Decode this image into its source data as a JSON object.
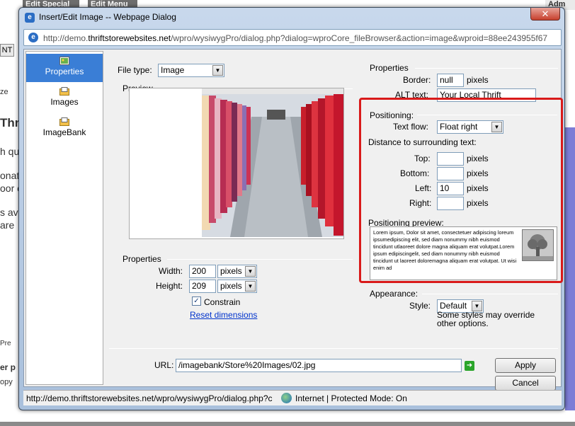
{
  "background_page": {
    "tab1": "Edit Special",
    "tab2": "Edit Menu",
    "tab3": "Adm",
    "button_nt": "NT",
    "frag_ze": "ze",
    "frag_thr": "Thr",
    "frag_h_qu": "h qu",
    "frag_onat": "onat",
    "frag_oor_c": "oor c",
    "frag_s_ava": "s ava",
    "frag_are": "are",
    "frag_pre": "Pre",
    "frag_er_p": "er p",
    "frag_opy": "opy"
  },
  "window": {
    "title": "Insert/Edit Image -- Webpage Dialog",
    "close_label": "✕",
    "url_prefix": "http://demo.",
    "url_domain": "thriftstorewebsites.net",
    "url_rest": "/wpro/wysiwygPro/dialog.php?dialog=wproCore_fileBrowser&action=image&wproid=88ee243955f67"
  },
  "nav": {
    "items": [
      {
        "label": "Properties",
        "active": true
      },
      {
        "label": "Images",
        "active": false
      },
      {
        "label": "ImageBank",
        "active": false
      }
    ]
  },
  "filetype": {
    "label": "File type:",
    "value": "Image"
  },
  "preview": {
    "label": "Preview"
  },
  "left_properties": {
    "label": "Properties",
    "width_label": "Width:",
    "width_value": "200",
    "width_unit": "pixels",
    "height_label": "Height:",
    "height_value": "209",
    "height_unit": "pixels",
    "constrain_label": "Constrain",
    "constrain_checked": true,
    "reset_label": "Reset dimensions"
  },
  "right_properties": {
    "label": "Properties",
    "border_label": "Border:",
    "border_value": "null",
    "border_unit": "pixels",
    "alt_label": "ALT text:",
    "alt_value": "Your Local Thrift"
  },
  "positioning": {
    "label": "Positioning:",
    "textflow_label": "Text flow:",
    "textflow_value": "Float right",
    "distance_label": "Distance to surrounding text:",
    "top_label": "Top:",
    "top_value": "",
    "bottom_label": "Bottom:",
    "bottom_value": "",
    "left_label": "Left:",
    "left_value": "10",
    "right_label": "Right:",
    "right_value": "",
    "unit": "pixels",
    "preview_label": "Positioning preview:",
    "preview_text": "Lorem ipsum, Dolor sit amet, consectetuer adipiscing loreum ipsumedipiscing elit, sed diam nonummy nibh euismod tincidunt utlaoreet dolore magna aliquam erat volutpat.Lorem ipsum edipiscingelit, sed diam nonummy nibh euismod tincidunt ut laoreet doloremagna aliquam erat volutpat. Ut wisi enim ad"
  },
  "appearance": {
    "label": "Appearance:",
    "style_label": "Style:",
    "style_value": "Default",
    "note": "Some styles may override other options."
  },
  "footer": {
    "url_label": "URL:",
    "url_value": "/imagebank/Store%20Images/02.jpg",
    "apply_label": "Apply",
    "cancel_label": "Cancel"
  },
  "status": {
    "url": "http://demo.thriftstorewebsites.net/wpro/wysiwygPro/dialog.php?c",
    "zone": "Internet | Protected Mode: On"
  },
  "colors": {
    "highlight": "#d91a1a",
    "nav_active": "#3a7ed6",
    "link": "#0033cc"
  }
}
